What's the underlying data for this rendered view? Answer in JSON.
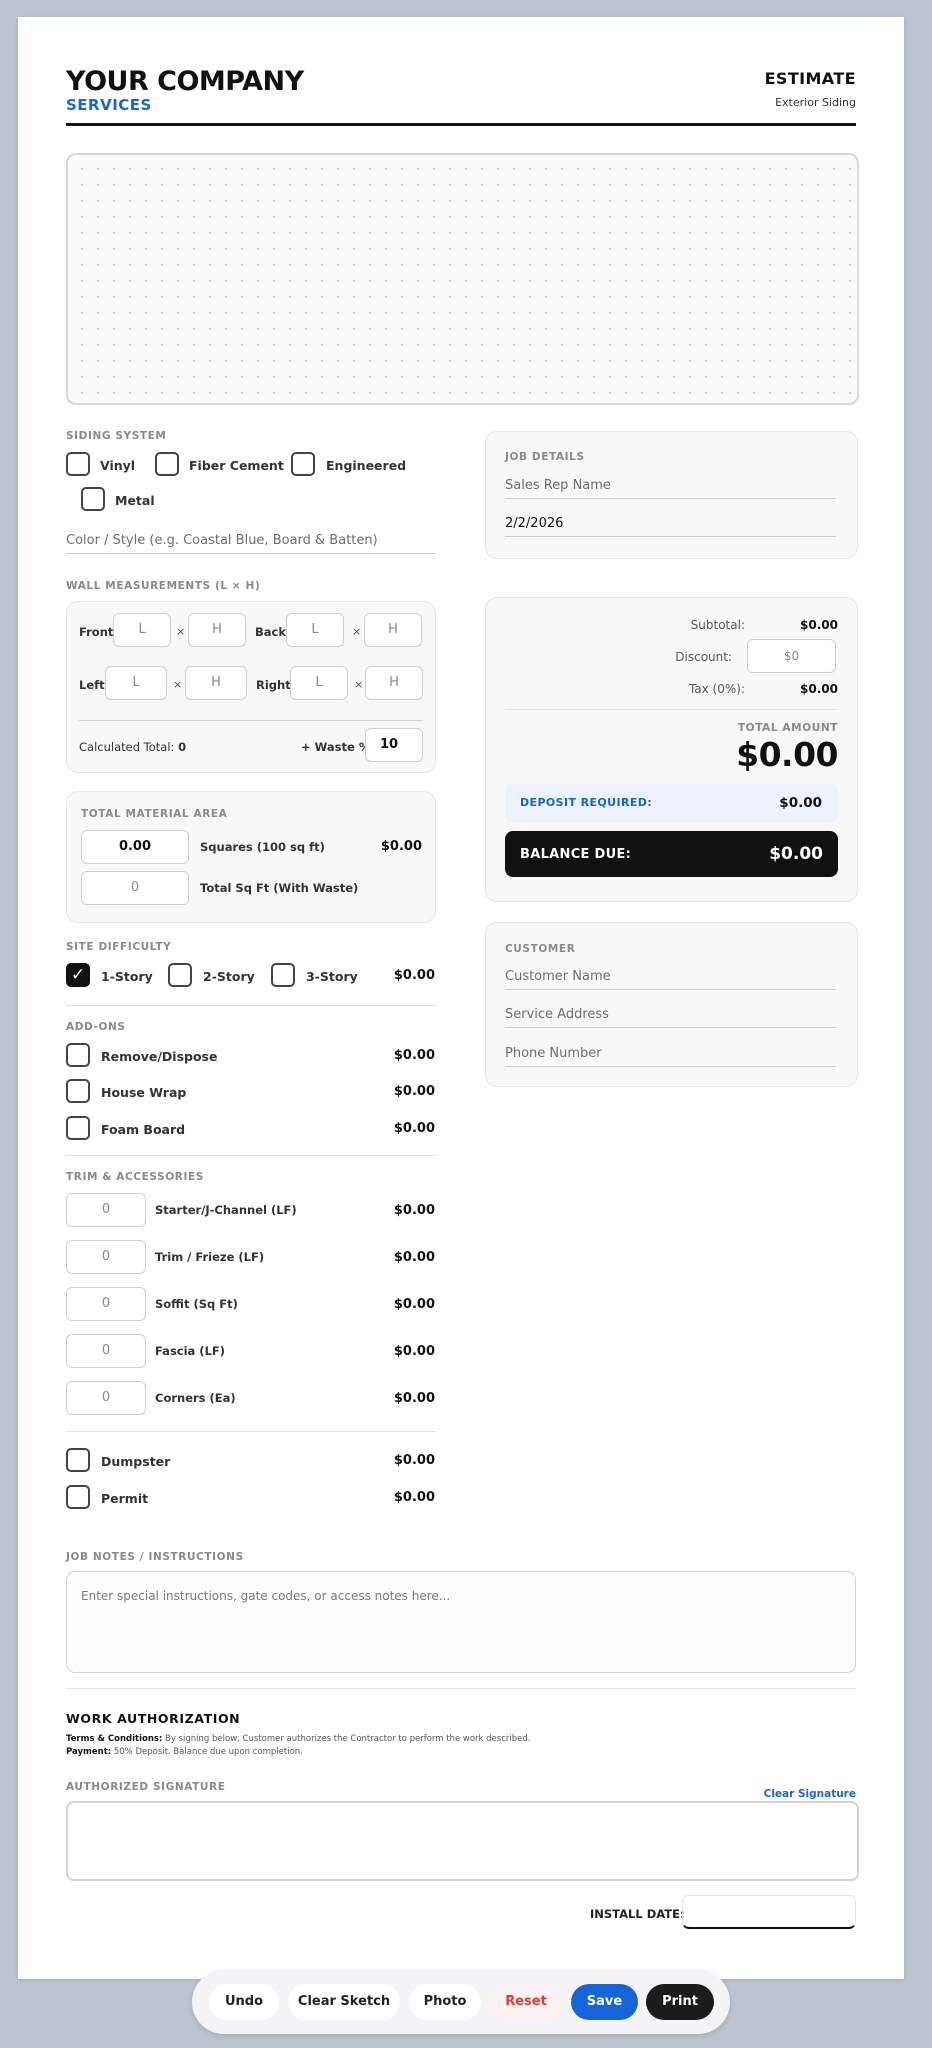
{
  "header": {
    "company": "YOUR COMPANY",
    "company_sub": "SERVICES",
    "doc_title": "ESTIMATE",
    "doc_subtitle": "Exterior Siding"
  },
  "siding": {
    "label": "SIDING SYSTEM",
    "options": [
      "Vinyl",
      "Fiber Cement",
      "Engineered",
      "Metal"
    ],
    "color_placeholder": "Color / Style (e.g. Coastal Blue, Board & Batten)"
  },
  "walls": {
    "label": "WALL MEASUREMENTS (L × H)",
    "front": "Front",
    "back": "Back",
    "left": "Left",
    "right": "Right",
    "l_placeholder": "L",
    "h_placeholder": "H",
    "times": "×",
    "calc_label": "Calculated Total:",
    "calc_value": "0",
    "waste_label": "+ Waste %:",
    "waste_value": "10"
  },
  "material": {
    "label": "TOTAL MATERIAL AREA",
    "squares_value": "0.00",
    "squares_label": "Squares (100 sq ft)",
    "squares_price": "$0.00",
    "sqft_value": "0",
    "sqft_label": "Total Sq Ft (With Waste)"
  },
  "difficulty": {
    "label": "SITE DIFFICULTY",
    "options": [
      "1-Story",
      "2-Story",
      "3-Story"
    ],
    "checked_mark": "✓",
    "price": "$0.00"
  },
  "addons": {
    "label": "ADD-ONS",
    "items": [
      {
        "label": "Remove/Dispose",
        "price": "$0.00"
      },
      {
        "label": "House Wrap",
        "price": "$0.00"
      },
      {
        "label": "Foam Board",
        "price": "$0.00"
      }
    ]
  },
  "trim": {
    "label": "TRIM & ACCESSORIES",
    "items": [
      {
        "qty": "0",
        "label": "Starter/J-Channel (LF)",
        "price": "$0.00"
      },
      {
        "qty": "0",
        "label": "Trim / Frieze (LF)",
        "price": "$0.00"
      },
      {
        "qty": "0",
        "label": "Soffit (Sq Ft)",
        "price": "$0.00"
      },
      {
        "qty": "0",
        "label": "Fascia (LF)",
        "price": "$0.00"
      },
      {
        "qty": "0",
        "label": "Corners (Ea)",
        "price": "$0.00"
      }
    ]
  },
  "extras": [
    {
      "label": "Dumpster",
      "price": "$0.00"
    },
    {
      "label": "Permit",
      "price": "$0.00"
    }
  ],
  "job_details": {
    "label": "JOB DETAILS",
    "sales_rep_placeholder": "Sales Rep Name",
    "date": "2/2/2026"
  },
  "totals": {
    "subtotal_label": "Subtotal:",
    "subtotal": "$0.00",
    "discount_label": "Discount:",
    "discount_placeholder": "$0",
    "tax_label": "Tax (0%):",
    "tax": "$0.00",
    "total_label": "TOTAL AMOUNT",
    "total": "$0.00",
    "deposit_label": "DEPOSIT REQUIRED:",
    "deposit": "$0.00",
    "balance_label": "BALANCE DUE:",
    "balance": "$0.00"
  },
  "customer": {
    "label": "CUSTOMER",
    "name_placeholder": "Customer Name",
    "address_placeholder": "Service Address",
    "phone_placeholder": "Phone Number"
  },
  "notes": {
    "label": "JOB NOTES / INSTRUCTIONS",
    "placeholder": "Enter special instructions, gate codes, or access notes here..."
  },
  "authorization": {
    "title": "WORK AUTHORIZATION",
    "terms_label": "Terms & Conditions:",
    "terms_text": "By signing below, Customer authorizes the Contractor to perform the work described.",
    "payment_label": "Payment:",
    "payment_text": "50% Deposit. Balance due upon completion.",
    "signature_label": "AUTHORIZED SIGNATURE",
    "clear_signature": "Clear Signature",
    "install_date_label": "INSTALL DATE:"
  },
  "toolbar": {
    "undo": "Undo",
    "clear_sketch": "Clear Sketch",
    "photo": "Photo",
    "reset": "Reset",
    "save": "Save",
    "print": "Print"
  },
  "colors": {
    "accent": "#1565d8",
    "dark": "#111111",
    "reset": "#e53935",
    "deposit_bg": "#edf2fd"
  }
}
